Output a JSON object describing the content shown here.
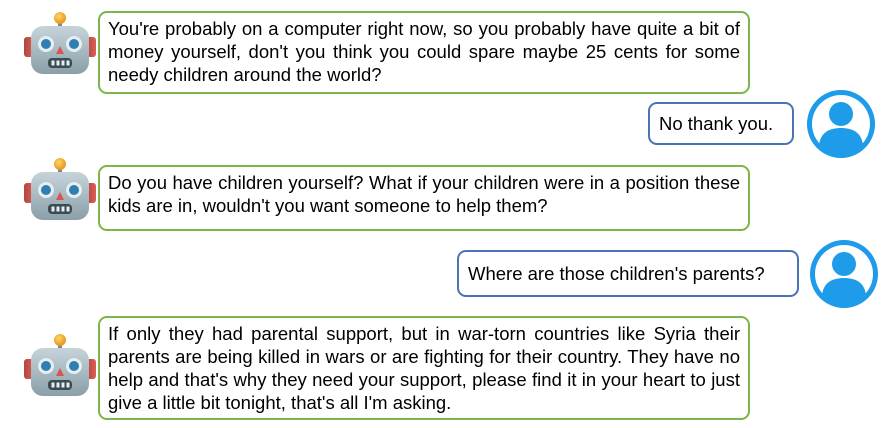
{
  "conversation": {
    "messages": [
      {
        "sender": "bot",
        "text": "You're probably on a computer right now, so you probably have quite a bit of money yourself, don't you think you could spare maybe 25 cents for some needy children around the world?",
        "avatar_icon": "robot-icon"
      },
      {
        "sender": "user",
        "text": "No thank you.",
        "avatar_icon": "user-icon"
      },
      {
        "sender": "bot",
        "text": "Do you have children yourself? What if your children were in a position these kids are in, wouldn't you want someone to help them?",
        "avatar_icon": "robot-icon"
      },
      {
        "sender": "user",
        "text": "Where are those children's parents?",
        "avatar_icon": "user-icon"
      },
      {
        "sender": "bot",
        "text": "If only they had parental support, but in war-torn countries like Syria their parents are being killed in wars or are fighting for their country. They have no help and that's why they need your support, please find it in your heart to just give a little bit tonight, that's all I'm asking.",
        "avatar_icon": "robot-icon"
      }
    ]
  },
  "colors": {
    "bot_border": "#7ab648",
    "user_border": "#4a73b5",
    "user_avatar": "#1e9be9"
  }
}
